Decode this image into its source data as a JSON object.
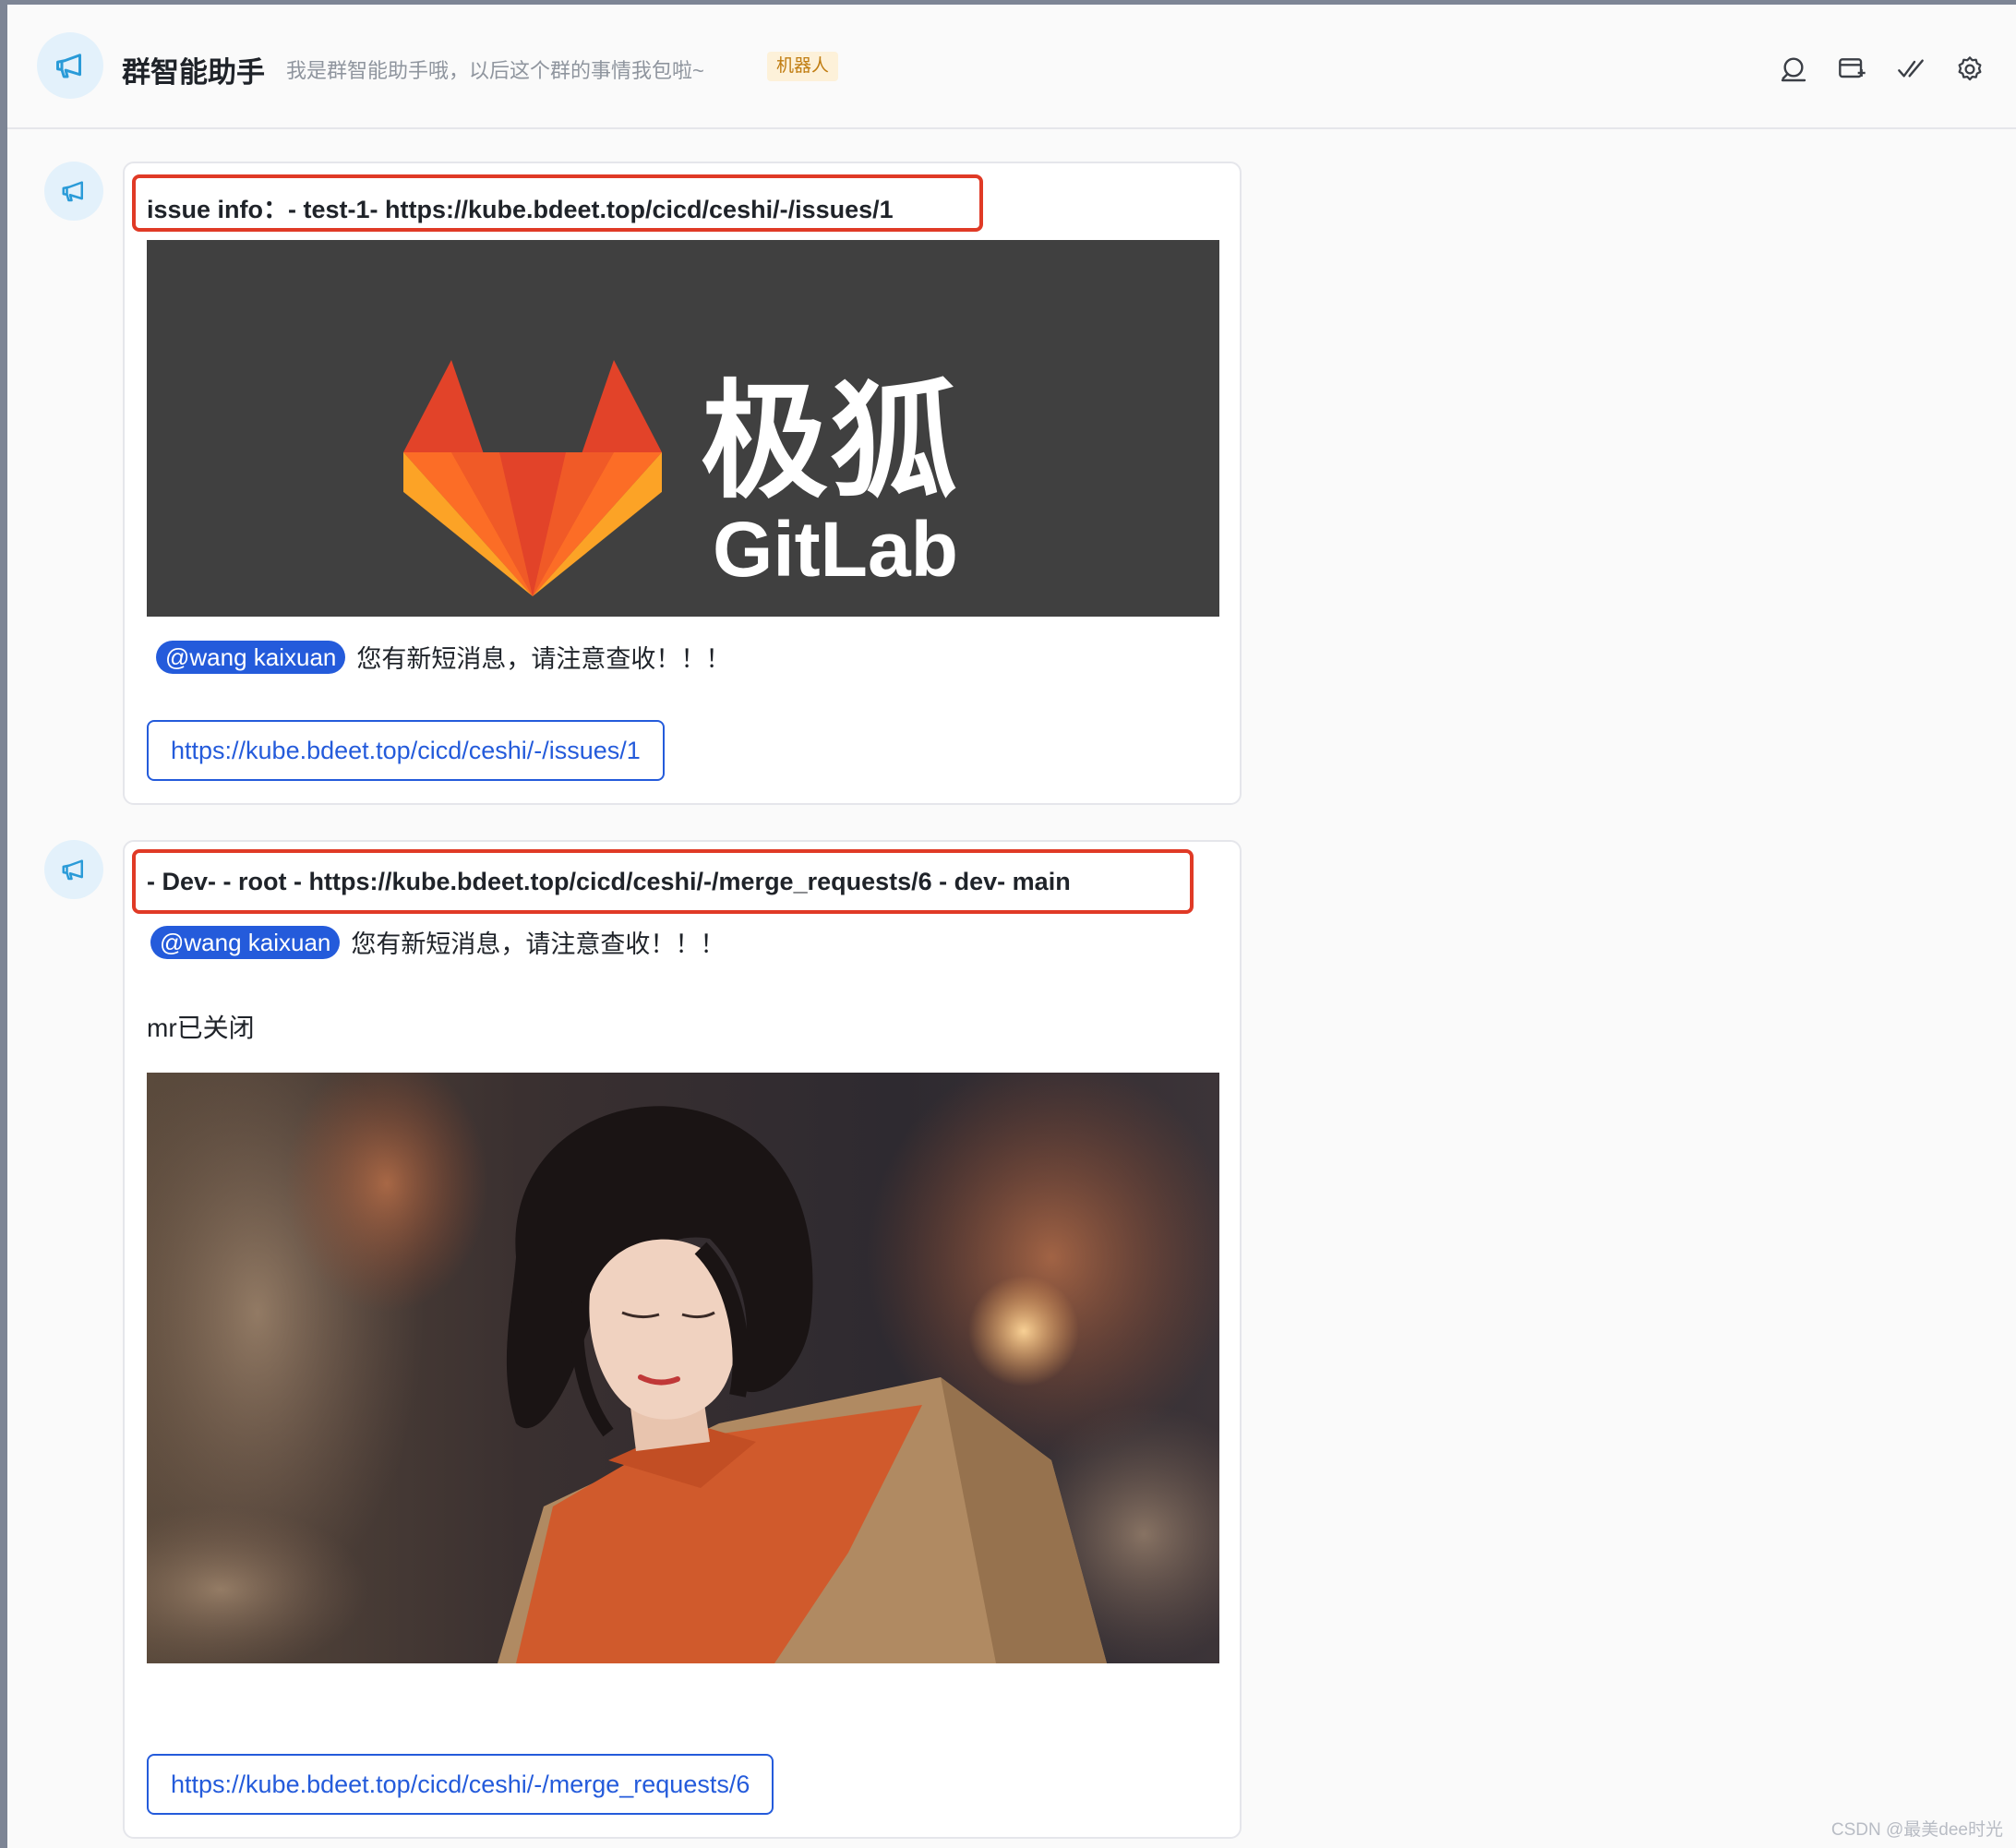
{
  "header": {
    "title": "群智能助手",
    "subtitle": "我是群智能助手哦，以后这个群的事情我包啦~",
    "badge": "机器人",
    "icons": [
      "search-icon",
      "add-tab-icon",
      "checkmark-icon",
      "settings-icon"
    ]
  },
  "messages": [
    {
      "title": "issue info：-  test-1-  https://kube.bdeet.top/cicd/ceshi/-/issues/1",
      "banner": {
        "logo_cn": "极狐",
        "logo_en": "GitLab"
      },
      "mention": "@wang kaixuan",
      "mention_text": "您有新短消息，请注意查收！！！",
      "link": "https://kube.bdeet.top/cicd/ceshi/-/issues/1"
    },
    {
      "title": "- Dev-   - root - https://kube.bdeet.top/cicd/ceshi/-/merge_requests/6 - dev-  main",
      "mention": "@wang kaixuan",
      "mention_text": "您有新短消息，请注意查收！！！",
      "status_text": "mr已关闭",
      "link": "https://kube.bdeet.top/cicd/ceshi/-/merge_requests/6"
    }
  ],
  "watermark": "CSDN @最美dee时光",
  "colors": {
    "accent": "#245bdb",
    "highlight_box": "#e03a26",
    "badge_bg": "#fdf1d9",
    "badge_text": "#c07c10",
    "avatar_bg": "#e3f1fb"
  }
}
